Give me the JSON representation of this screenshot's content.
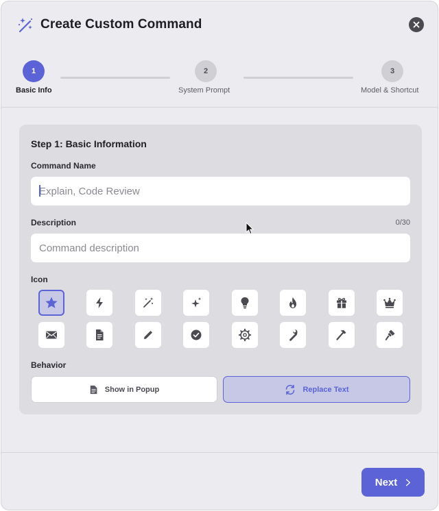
{
  "dialog": {
    "title": "Create Custom Command"
  },
  "steps": [
    {
      "number": "1",
      "label": "Basic Info",
      "state": "active"
    },
    {
      "number": "2",
      "label": "System Prompt",
      "state": "inactive"
    },
    {
      "number": "3",
      "label": "Model & Shortcut",
      "state": "inactive"
    }
  ],
  "form": {
    "section_title": "Step 1: Basic Information",
    "command_name": {
      "label": "Command Name",
      "value": "",
      "placeholder": "Explain, Code Review"
    },
    "description": {
      "label": "Description",
      "value": "",
      "placeholder": "Command description",
      "counter": "0/30"
    },
    "icon": {
      "label": "Icon",
      "selected": "star-icon",
      "options": [
        "star-icon",
        "bolt-icon",
        "magic-wand-icon",
        "sparkles-icon",
        "lightbulb-icon",
        "flame-icon",
        "gift-icon",
        "crown-icon",
        "envelope-icon",
        "document-icon",
        "pencil-icon",
        "checkmark-circle-icon",
        "gear-icon",
        "wrench-icon",
        "hammer-icon",
        "paintbrush-icon"
      ]
    },
    "behavior": {
      "label": "Behavior",
      "options": [
        {
          "id": "popup",
          "label": "Show in Popup",
          "icon": "document-icon",
          "selected": false
        },
        {
          "id": "replace",
          "label": "Replace Text",
          "icon": "arrows-cycle-icon",
          "selected": true
        }
      ]
    }
  },
  "footer": {
    "next_label": "Next"
  },
  "colors": {
    "accent": "#5b63d6",
    "accent_light": "#c6c8e6",
    "background": "#ebebf0",
    "card": "#dcdce1"
  }
}
